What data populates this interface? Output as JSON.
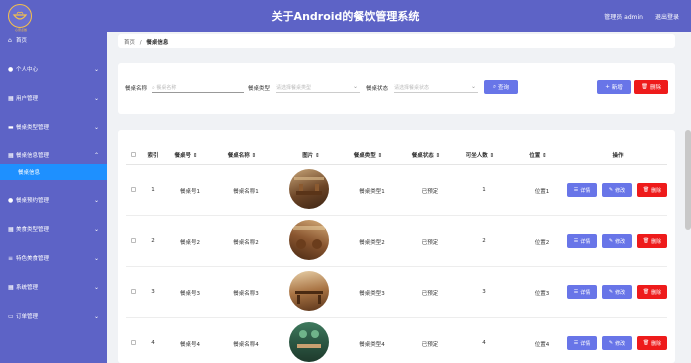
{
  "header": {
    "title": "关于Android的餐饮管理系统",
    "logo_text": "心意点餐",
    "user_label": "管理员 admin",
    "logout_label": "退出登录"
  },
  "sidebar": {
    "items": [
      {
        "label": "首页",
        "icon": "home-icon",
        "has_arrow": false
      },
      {
        "label": "个人中心",
        "icon": "user-icon",
        "has_arrow": true
      },
      {
        "label": "用户管理",
        "icon": "grid-icon",
        "has_arrow": true
      },
      {
        "label": "餐桌类型管理",
        "icon": "table-icon",
        "has_arrow": true
      },
      {
        "label": "餐桌信息管理",
        "icon": "grid-icon",
        "has_arrow": true
      },
      {
        "label": "餐桌信息",
        "icon": "",
        "has_arrow": false,
        "active": true
      },
      {
        "label": "餐桌预约管理",
        "icon": "user-icon",
        "has_arrow": true
      },
      {
        "label": "美食类型管理",
        "icon": "grid-icon",
        "has_arrow": true
      },
      {
        "label": "特色美食管理",
        "icon": "filter-icon",
        "has_arrow": true
      },
      {
        "label": "系统管理",
        "icon": "grid-icon",
        "has_arrow": true
      },
      {
        "label": "订单管理",
        "icon": "chat-icon",
        "has_arrow": true
      }
    ]
  },
  "breadcrumb": {
    "home": "首页",
    "separator": "/",
    "current": "餐桌信息"
  },
  "search": {
    "name_label": "餐桌名称",
    "name_placeholder": "餐桌名称",
    "type_label": "餐桌类型",
    "type_placeholder": "请选择餐桌类型",
    "status_label": "餐桌状态",
    "status_placeholder": "请选择餐桌状态",
    "query_label": "查询",
    "add_label": "新增",
    "delete_label": "删除"
  },
  "table": {
    "columns": [
      "索引",
      "餐桌号",
      "餐桌名称",
      "图片",
      "餐桌类型",
      "餐桌状态",
      "可坐人数",
      "位置",
      "操作"
    ],
    "action_labels": {
      "detail": "详情",
      "edit": "修改",
      "delete": "删除"
    },
    "rows": [
      {
        "index": "1",
        "table_no": "餐桌号1",
        "name": "餐桌名称1",
        "type": "餐桌类型1",
        "status": "已预定",
        "seats": "1",
        "location": "位置1"
      },
      {
        "index": "2",
        "table_no": "餐桌号2",
        "name": "餐桌名称2",
        "type": "餐桌类型2",
        "status": "已预定",
        "seats": "2",
        "location": "位置2"
      },
      {
        "index": "3",
        "table_no": "餐桌号3",
        "name": "餐桌名称3",
        "type": "餐桌类型3",
        "status": "已预定",
        "seats": "3",
        "location": "位置3"
      },
      {
        "index": "4",
        "table_no": "餐桌号4",
        "name": "餐桌名称4",
        "type": "餐桌类型4",
        "status": "已预定",
        "seats": "4",
        "location": "位置4"
      }
    ]
  },
  "colors": {
    "header_bg": "#5d63c6",
    "active_item": "#1e90ff",
    "primary_button": "#6875e8",
    "danger_button": "#ee1b1b"
  }
}
